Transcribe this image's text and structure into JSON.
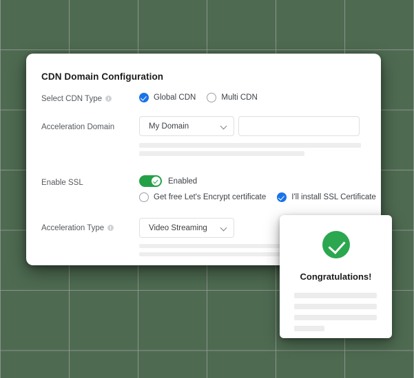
{
  "background": {
    "color": "#4e6b51",
    "grid_line_color": "#a0a0a0"
  },
  "config_card": {
    "title": "CDN Domain Configuration",
    "rows": {
      "cdn_type": {
        "label": "Select CDN Type",
        "info_icon": "info-icon",
        "options": [
          {
            "label": "Global CDN",
            "selected": true
          },
          {
            "label": "Multi CDN",
            "selected": false
          }
        ]
      },
      "acceleration_domain": {
        "label": "Acceleration Domain",
        "select_value": "My Domain",
        "select_icon": "chevron-down-icon",
        "text_value": "",
        "text_placeholder": ""
      },
      "enable_ssl": {
        "label": "Enable SSL",
        "toggle_state": "Enabled",
        "toggle_on": true,
        "toggle_color": "#24a148",
        "options": [
          {
            "label": "Get free Let's Encrypt certificate",
            "selected": false
          },
          {
            "label": "I'll install SSL Certificate",
            "selected": true
          }
        ]
      },
      "acceleration_type": {
        "label": "Acceleration Type",
        "info_icon": "info-icon",
        "select_value": "Video Streaming",
        "select_icon": "chevron-down-icon"
      }
    },
    "accent_color": "#1a73e8"
  },
  "congrats_card": {
    "icon": "check-circle-icon",
    "icon_color": "#2ba74f",
    "title": "Congratulations!",
    "placeholder_lines": 4
  }
}
